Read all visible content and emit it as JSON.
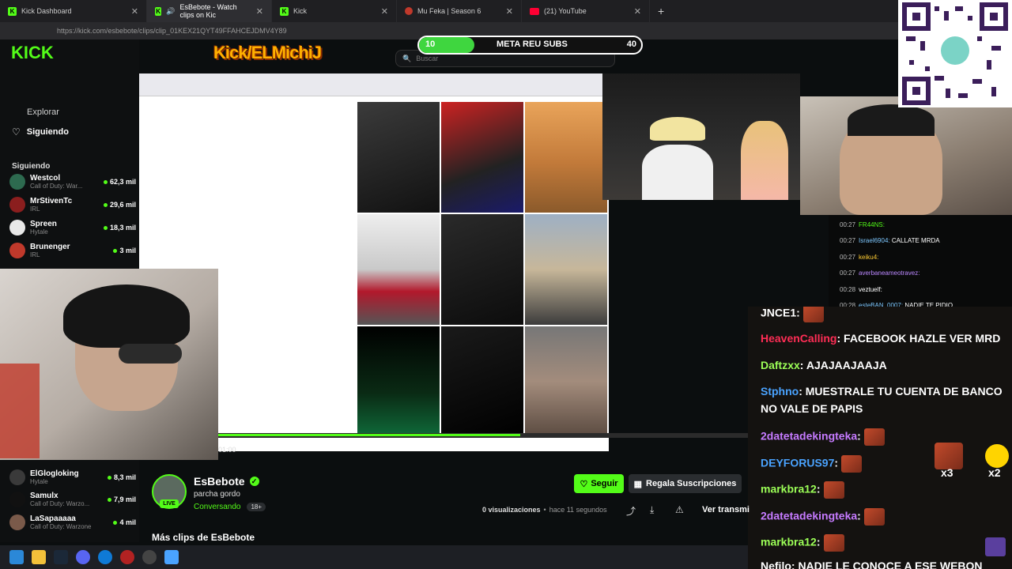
{
  "browser": {
    "tabs": [
      {
        "label": "Kick Dashboard",
        "icon": "kick-icon"
      },
      {
        "label": "EsBebote - Watch clips on Kic",
        "icon": "kick-icon",
        "active": true
      },
      {
        "label": "Kick",
        "icon": "kick-icon"
      },
      {
        "label": "Mu Feka | Season 6",
        "icon": "mu-icon"
      },
      {
        "label": "(21) YouTube",
        "icon": "youtube-icon"
      }
    ],
    "new_tab": "+",
    "url": "https://kick.com/esbebote/clips/clip_01KEX21QYT49FFAHCEJDMV4Y89"
  },
  "header": {
    "search_placeholder": "Buscar",
    "overlay_logo": "Kick/ELMichiJ",
    "meta": {
      "label": "META REU SUBS",
      "current": "10",
      "goal": "40",
      "progress": 0.25
    }
  },
  "sidebar": {
    "explore": "Explorar",
    "following_link": "Siguiendo",
    "section_title": "Siguiendo",
    "channels": [
      {
        "name": "Westcol",
        "game": "Call of Duty: War...",
        "viewers": "62,3 mil"
      },
      {
        "name": "MrStivenTc",
        "game": "IRL",
        "viewers": "29,6 mil"
      },
      {
        "name": "Spreen",
        "game": "Hytale",
        "viewers": "18,3 mil"
      },
      {
        "name": "Brunenger",
        "game": "IRL",
        "viewers": "3 mil"
      }
    ],
    "channels_lower": [
      {
        "name": "ElGlogloking",
        "game": "Hytale",
        "viewers": "8,3 mil"
      },
      {
        "name": "Samulx",
        "game": "Call of Duty: Warzo...",
        "viewers": "7,9 mil"
      },
      {
        "name": "LaSapaaaaa",
        "game": "Call of Duty: Warzone",
        "viewers": "4 mil"
      }
    ]
  },
  "player": {
    "time": "01:00",
    "progress": 0.57
  },
  "channel": {
    "name": "EsBebote",
    "subtitle": "parcha gordo",
    "category": "Conversando",
    "age_badge": "18+",
    "live_badge": "LIVE",
    "follow_label": "Seguir",
    "subscribe_label": "Regala Suscripciones",
    "views": "0 visualizaciones",
    "time_ago": "hace 11 segundos",
    "watch_stream": "Ver transmi",
    "more_clips": "Más clips de EsBebote"
  },
  "small_chat": [
    {
      "time": "00:27",
      "user": "FR44NS:",
      "text": "",
      "color": "#53fc18"
    },
    {
      "time": "00:27",
      "user": "Israel6904:",
      "text": "CALLATE MRDA",
      "color": "#7ec8ff"
    },
    {
      "time": "00:27",
      "user": "keiku4:",
      "text": "",
      "color": "#ffcc33"
    },
    {
      "time": "00:27",
      "user": "averbaneameotravez:",
      "text": "",
      "color": "#bb88ff"
    },
    {
      "time": "00:28",
      "user": "veztuelf:",
      "text": "",
      "color": "#ffffff"
    },
    {
      "time": "00:28",
      "user": "esteBAN_0007:",
      "text": "NADIE TE PIDIO",
      "color": "#7ec8ff"
    }
  ],
  "chat": [
    {
      "user": "JNCE1:",
      "text": "",
      "color": "#ffffff",
      "emote": true
    },
    {
      "user": "HeavenCalling",
      "text": ": FACEBOOK HAZLE VER MRD",
      "color": "#ff2d55"
    },
    {
      "user": "Daftzxx",
      "text": ": AJAJAAJAAJA",
      "color": "#9cff57"
    },
    {
      "user": "Stphno",
      "text": ": MUESTRALE TU CUENTA DE BANCO",
      "color": "#4aa3ff"
    },
    {
      "user": "",
      "text": "NO VALE DE PAPIS",
      "color": "#ffffff"
    },
    {
      "user": "2datetadekingteka",
      "text": ":",
      "color": "#c67bff",
      "emote": true
    },
    {
      "user": "DEYFORUS97",
      "text": ":",
      "color": "#4aa3ff",
      "emote": true
    },
    {
      "user": "markbra12",
      "text": ":",
      "color": "#9cff57",
      "emote": true
    },
    {
      "user": "2datetadekingteka",
      "text": ":",
      "color": "#c67bff",
      "emote": true
    },
    {
      "user": "markbra12",
      "text": ":",
      "color": "#9cff57",
      "emote": true
    },
    {
      "user": "Nefilo",
      "text": ": NADIE LE CONOCE A ESE WEBON",
      "color": "#ffffff"
    }
  ],
  "combo": {
    "first": "x3",
    "second": "x2"
  },
  "colors": {
    "kick_green": "#53fc18",
    "accent_orange": "#ffb000"
  }
}
